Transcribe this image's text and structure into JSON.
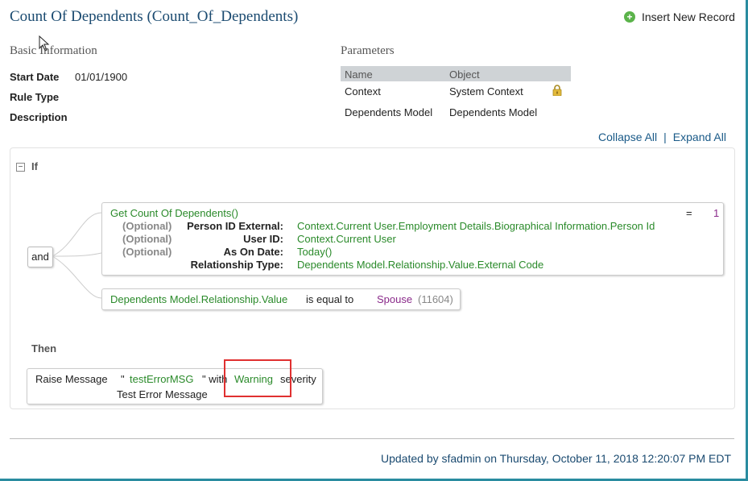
{
  "header": {
    "title": "Count Of Dependents (Count_Of_Dependents)",
    "insert_label": "Insert New Record"
  },
  "basic": {
    "heading": "Basic Information",
    "start_date_label": "Start Date",
    "start_date_value": "01/01/1900",
    "rule_type_label": "Rule Type",
    "description_label": "Description"
  },
  "parameters": {
    "heading": "Parameters",
    "columns": [
      "Name",
      "Object"
    ],
    "rows": [
      {
        "name": "Context",
        "object": "System Context",
        "locked": true
      },
      {
        "name": "Dependents Model",
        "object": "Dependents Model",
        "locked": false
      }
    ]
  },
  "toggles": {
    "collapse_all": "Collapse All",
    "separator": "|",
    "expand_all": "Expand All"
  },
  "rule": {
    "if_label": "If",
    "operator": "and",
    "condition1": {
      "function": "Get Count Of Dependents()",
      "comparator": "=",
      "value": "1",
      "params": [
        {
          "optional": "(Optional)",
          "label": "Person ID External:",
          "value": "Context.Current User.Employment Details.Biographical Information.Person Id"
        },
        {
          "optional": "(Optional)",
          "label": "User ID:",
          "value": "Context.Current User"
        },
        {
          "optional": "(Optional)",
          "label": "As On Date:",
          "value": "Today()"
        },
        {
          "optional": "",
          "label": "Relationship Type:",
          "value": "Dependents Model.Relationship.Value.External Code"
        }
      ]
    },
    "condition2": {
      "field": "Dependents Model.Relationship.Value",
      "operator": "is equal to",
      "value": "Spouse",
      "code": "(11604)"
    },
    "then_label": "Then",
    "action": {
      "verb": "Raise Message",
      "quote_open": "\"",
      "message_key": "testErrorMSG",
      "quote_close_with": "\" with",
      "severity": "Warning",
      "severity_suffix": "severity",
      "message_text": "Test Error Message"
    }
  },
  "footer": {
    "updated": "Updated by sfadmin on Thursday, October 11, 2018 12:20:07 PM EDT"
  },
  "colors": {
    "accent": "#2a8ca0",
    "title": "#1a4a70",
    "green": "#2a8a2a",
    "purple": "#8a2a8a",
    "highlight": "#e03030"
  }
}
